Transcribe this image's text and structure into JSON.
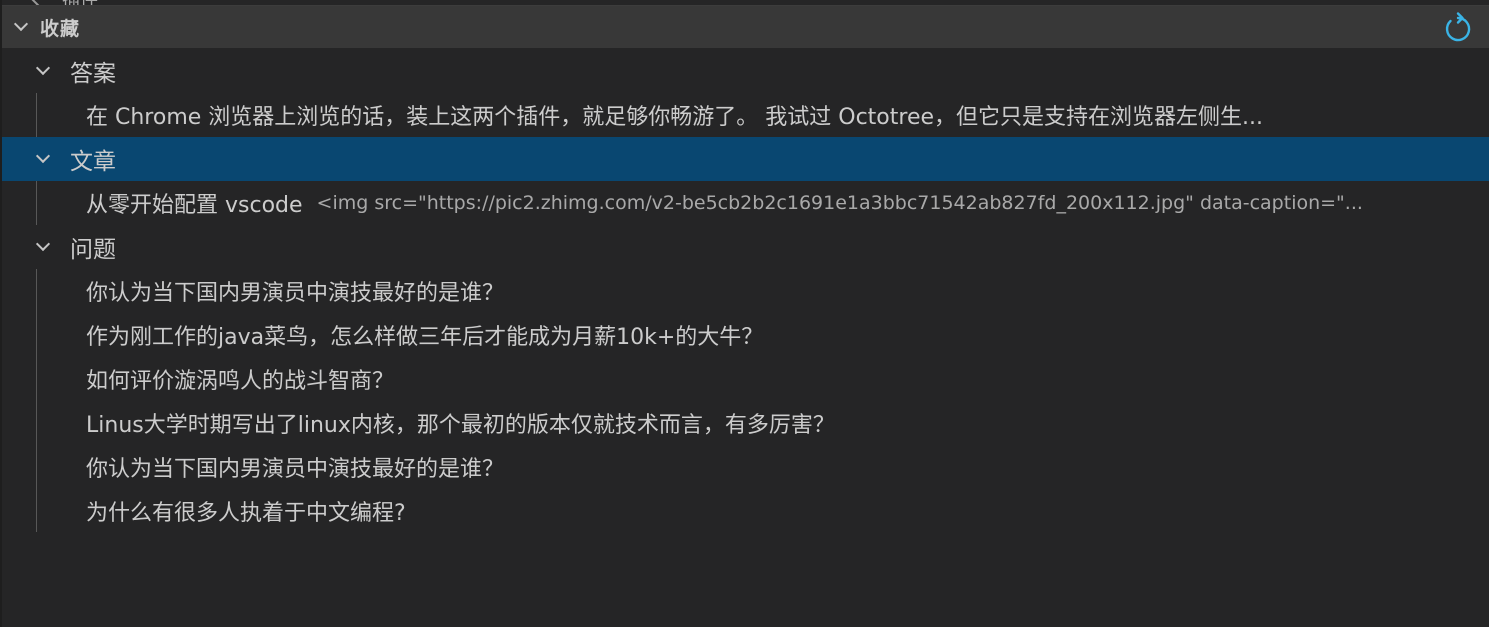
{
  "top_partial": {
    "label": "插件"
  },
  "section": {
    "title": "收藏",
    "refresh_icon": "refresh-icon"
  },
  "groups": {
    "answers": {
      "label": "答案",
      "items": [
        {
          "text": "在 Chrome 浏览器上浏览的话，装上这两个插件，就足够你畅游了。 我试过 Octotree，但它只是支持在浏览器左侧生..."
        }
      ]
    },
    "articles": {
      "label": "文章",
      "items": [
        {
          "text": "从零开始配置 vscode",
          "description": "<img src=\"https://pic2.zhimg.com/v2-be5cb2b2c1691e1a3bbc71542ab827fd_200x112.jpg\" data-caption=\"..."
        }
      ]
    },
    "questions": {
      "label": "问题",
      "items": [
        {
          "text": "你认为当下国内男演员中演技最好的是谁？"
        },
        {
          "text": "作为刚工作的java菜鸟，怎么样做三年后才能成为月薪10k+的大牛？"
        },
        {
          "text": "如何评价漩涡鸣人的战斗智商？"
        },
        {
          "text": "Linus大学时期写出了linux内核，那个最初的版本仅就技术而言，有多厉害？"
        },
        {
          "text": "你认为当下国内男演员中演技最好的是谁？"
        },
        {
          "text": "为什么有很多人执着于中文编程?"
        }
      ]
    }
  },
  "colors": {
    "background": "#252526",
    "header": "#383838",
    "selection": "#094771",
    "refresh_accent": "#3794ff"
  }
}
